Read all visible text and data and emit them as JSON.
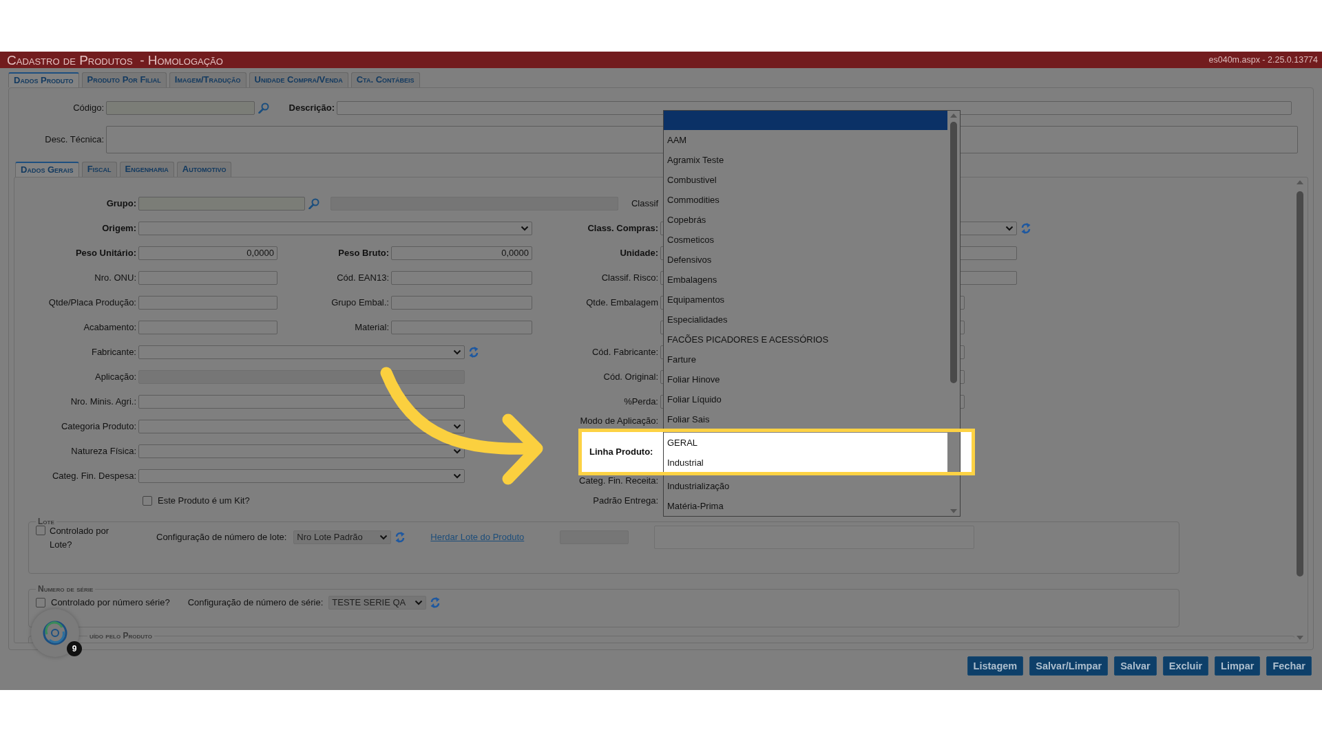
{
  "header": {
    "title": "Cadastro de Produtos  - Homologação",
    "version": "es040m.aspx - 2.25.0.13774"
  },
  "tabs": [
    {
      "label": "Dados Produto",
      "selected": true
    },
    {
      "label": "Produto Por Filial",
      "selected": false
    },
    {
      "label": "Imagem/Tradução",
      "selected": false
    },
    {
      "label": "Unidade Compra/Venda",
      "selected": false
    },
    {
      "label": "Cta. Contábeis",
      "selected": false
    }
  ],
  "top_fields": [
    {
      "label": "Código:",
      "bold": false,
      "kind": "lookup"
    },
    {
      "label": "Descrição:",
      "bold": true,
      "kind": "input"
    },
    {
      "label": "Desc. Técnica:",
      "bold": false,
      "kind": "textarea"
    }
  ],
  "sub_tabs": [
    {
      "label": "Dados Gerais",
      "selected": true
    },
    {
      "label": "Fiscal",
      "selected": false
    },
    {
      "label": "Engenharia",
      "selected": false
    },
    {
      "label": "Automotivo",
      "selected": false
    }
  ],
  "rows": [
    {
      "left": [
        {
          "label": "Grupo:",
          "bold": true,
          "kind": "lookup"
        }
      ],
      "right": {
        "label": "Classif",
        "bold": false,
        "kind": "hidden"
      }
    },
    {
      "left": [
        {
          "label": "Origem:",
          "bold": true,
          "kind": "wide-select"
        }
      ],
      "right": {
        "label": "Class. Compras:",
        "bold": true,
        "kind": "select"
      }
    },
    {
      "left": [
        {
          "label": "Peso Unitário:",
          "bold": true,
          "kind": "number",
          "value": "0,0000"
        },
        {
          "label": "Peso Bruto:",
          "bold": true,
          "kind": "number",
          "value": "0,0000"
        }
      ],
      "right": {
        "label": "Unidade:",
        "bold": true,
        "kind": "input"
      }
    },
    {
      "left": [
        {
          "label": "Nro. ONU:",
          "bold": false,
          "kind": "input"
        },
        {
          "label": "Cód. EAN13:",
          "bold": false,
          "kind": "input"
        }
      ],
      "right": {
        "label": "Classif. Risco:",
        "bold": false,
        "kind": "input"
      }
    },
    {
      "left": [
        {
          "label": "Qtde/Placa Produção:",
          "bold": false,
          "kind": "input"
        },
        {
          "label": "Grupo Embal.:",
          "bold": false,
          "kind": "input"
        }
      ],
      "right": {
        "label": "Qtde. Embalagem",
        "bold": false,
        "kind": "stub"
      }
    },
    {
      "left": [
        {
          "label": "Acabamento:",
          "bold": false,
          "kind": "input"
        },
        {
          "label": "Material:",
          "bold": false,
          "kind": "input"
        }
      ],
      "right": {
        "kind": "stub"
      }
    },
    {
      "left": [
        {
          "label": "Fabricante:",
          "bold": false,
          "kind": "select-refresh"
        }
      ],
      "right": {
        "label": "Cód. Fabricante:",
        "bold": false,
        "kind": "stub"
      }
    },
    {
      "left": [
        {
          "label": "Aplicação:",
          "bold": false,
          "kind": "disabled"
        }
      ],
      "right": {
        "label": "Cód. Original:",
        "bold": false,
        "kind": "stub"
      }
    },
    {
      "left": [
        {
          "label": "Nro. Minis. Agri.:",
          "bold": false,
          "kind": "input"
        }
      ],
      "right": {
        "label": "%Perda:",
        "bold": false,
        "kind": "stub"
      }
    },
    {
      "left": [
        {
          "label": "Categoria Produto:",
          "bold": false,
          "kind": "select"
        }
      ],
      "right": {
        "label": "Modo de Aplicação:",
        "bold": false,
        "kind": "hidden"
      }
    },
    {
      "left": [
        {
          "label": "Natureza Física:",
          "bold": false,
          "kind": "select"
        }
      ]
    },
    {
      "left": [
        {
          "label": "Categ. Fin. Despesa:",
          "bold": false,
          "kind": "select"
        }
      ],
      "right": {
        "label": "Categ. Fin. Receita:",
        "bold": false,
        "kind": "hidden"
      }
    },
    {
      "left": [
        {
          "label": "Este Produto é um Kit?",
          "kind": "checkbox",
          "checked": false
        }
      ],
      "right": {
        "label": "Padrão Entrega:",
        "bold": false,
        "kind": "hidden"
      }
    }
  ],
  "lote": {
    "legend": "Lote",
    "checkbox": {
      "label": "Controlado por Lote?",
      "checked": false
    },
    "config_label": "Configuração de número de lote:",
    "config_value": "Nro Lote Padrão",
    "link": "Herdar Lote do Produto"
  },
  "serie": {
    "legend": "Numero de série",
    "checkbox": {
      "label": "Controlado por número série?",
      "checked": false
    },
    "config_label": "Configuração de número de série:",
    "config_value": "TESTE SERIE QA"
  },
  "next_section": {
    "legend": "uído pelo Produto"
  },
  "dropdown": {
    "items": [
      {
        "selected": true,
        "spotlit": false
      },
      {
        "label": "AAM",
        "selected": false,
        "spotlit": false
      },
      {
        "label": "Agramix Teste",
        "selected": false,
        "spotlit": false
      },
      {
        "label": "Combustivel",
        "selected": false,
        "spotlit": false
      },
      {
        "label": "Commodities",
        "selected": false,
        "spotlit": false
      },
      {
        "label": "Copebrás",
        "selected": false,
        "spotlit": false
      },
      {
        "label": "Cosmeticos",
        "selected": false,
        "spotlit": false
      },
      {
        "label": "Defensivos",
        "selected": false,
        "spotlit": false
      },
      {
        "label": "Embalagens",
        "selected": false,
        "spotlit": false
      },
      {
        "label": "Equipamentos",
        "selected": false,
        "spotlit": false
      },
      {
        "label": "Especialidades",
        "selected": false,
        "spotlit": false
      },
      {
        "label": "FACÕES PICADORES E ACESSÓRIOS",
        "selected": false,
        "spotlit": false
      },
      {
        "label": "Farture",
        "selected": false,
        "spotlit": false
      },
      {
        "label": "Foliar Hinove",
        "selected": false,
        "spotlit": false
      },
      {
        "label": "Foliar Líquido",
        "selected": false,
        "spotlit": false
      },
      {
        "label": "Foliar Sais",
        "selected": false,
        "spotlit": false
      },
      {
        "label": "GERAL",
        "selected": false,
        "spotlit": true
      },
      {
        "label": "Industrial",
        "selected": false,
        "spotlit": true
      },
      {
        "label": "Industrialização",
        "selected": false,
        "spotlit": false
      },
      {
        "label": "Matéria-Prima",
        "selected": false,
        "spotlit": false
      }
    ]
  },
  "spotlight": {
    "label": "Linha Produto:"
  },
  "buttons": [
    "Listagem",
    "Salvar/Limpar",
    "Salvar",
    "Excluir",
    "Limpar",
    "Fechar"
  ],
  "chat_widget": {
    "badge": "9"
  }
}
